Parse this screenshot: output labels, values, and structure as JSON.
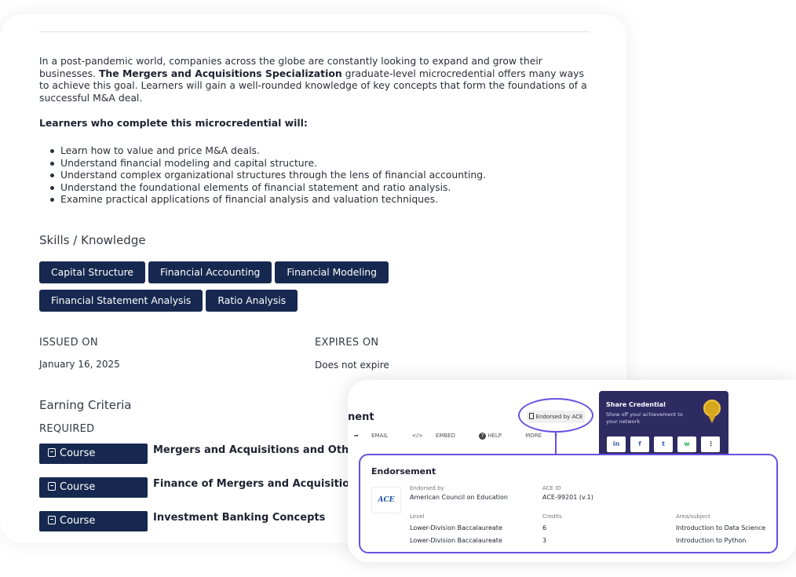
{
  "description": {
    "intro_1": "In a post-pandemic world, companies across the globe are constantly looking to expand and grow their businesses. ",
    "intro_bold": "The Mergers and Acquisitions Specialization",
    "intro_2": " graduate-level microcredential offers many ways to achieve this goal. Learners will gain a well-rounded knowledge of key concepts that form the foundations of a successful M&A deal.",
    "learners_heading": "Learners who complete this microcredential will:",
    "outcomes": [
      "Learn how to value and price M&A deals.",
      "Understand financial modeling and capital structure.",
      "Understand complex organizational structures through the lens of financial accounting.",
      "Understand the foundational elements of financial statement and ratio analysis.",
      "Examine practical applications of financial analysis and valuation techniques."
    ]
  },
  "skills": {
    "heading": "Skills / Knowledge",
    "tags": [
      "Capital Structure",
      "Financial Accounting",
      "Financial Modeling",
      "Financial Statement Analysis",
      "Ratio Analysis"
    ]
  },
  "dates": {
    "issued_label": "ISSUED ON",
    "issued_value": "January 16, 2025",
    "expires_label": "EXPIRES ON",
    "expires_value": "Does not expire"
  },
  "criteria": {
    "heading": "Earning Criteria",
    "required_label": "REQUIRED",
    "courses": [
      {
        "badge": "Course",
        "title": "Mergers and Acquisitions and Other"
      },
      {
        "badge": "Course",
        "title": "Finance of Mergers and Acquisitions"
      },
      {
        "badge": "Course",
        "title": "Investment Banking Concepts"
      }
    ]
  },
  "overlay": {
    "partial_title": "nent",
    "actions": {
      "email": "EMAIL",
      "embed": "EMBED",
      "help": "HELP",
      "more": "MORE"
    },
    "endorsed_pill": "Endorsed by ACE",
    "share": {
      "title": "Share Credential",
      "subtitle": "Show off your achievement to your network",
      "icons": [
        "in",
        "f",
        "t",
        "w",
        "⋮"
      ]
    },
    "endorsement": {
      "title": "Endorsement",
      "logo_text": "ACE",
      "endorsed_by_label": "Endorsed by",
      "endorsed_by_value": "American Council on Education",
      "ace_id_label": "ACE ID",
      "ace_id_value": "ACE-99201 (v.1)",
      "level_label": "Level",
      "credits_label": "Credits",
      "area_label": "Area/subject",
      "rows": [
        {
          "level": "Lower-Division Baccalaureate",
          "credits": "6",
          "area": "Introduction to Data Science"
        },
        {
          "level": "Lower-Division Baccalaureate",
          "credits": "3",
          "area": "Introduction to Python"
        }
      ]
    }
  },
  "colors": {
    "navy": "#16284f",
    "accent": "#6a4fe0",
    "share_bg": "#2e2b63"
  }
}
